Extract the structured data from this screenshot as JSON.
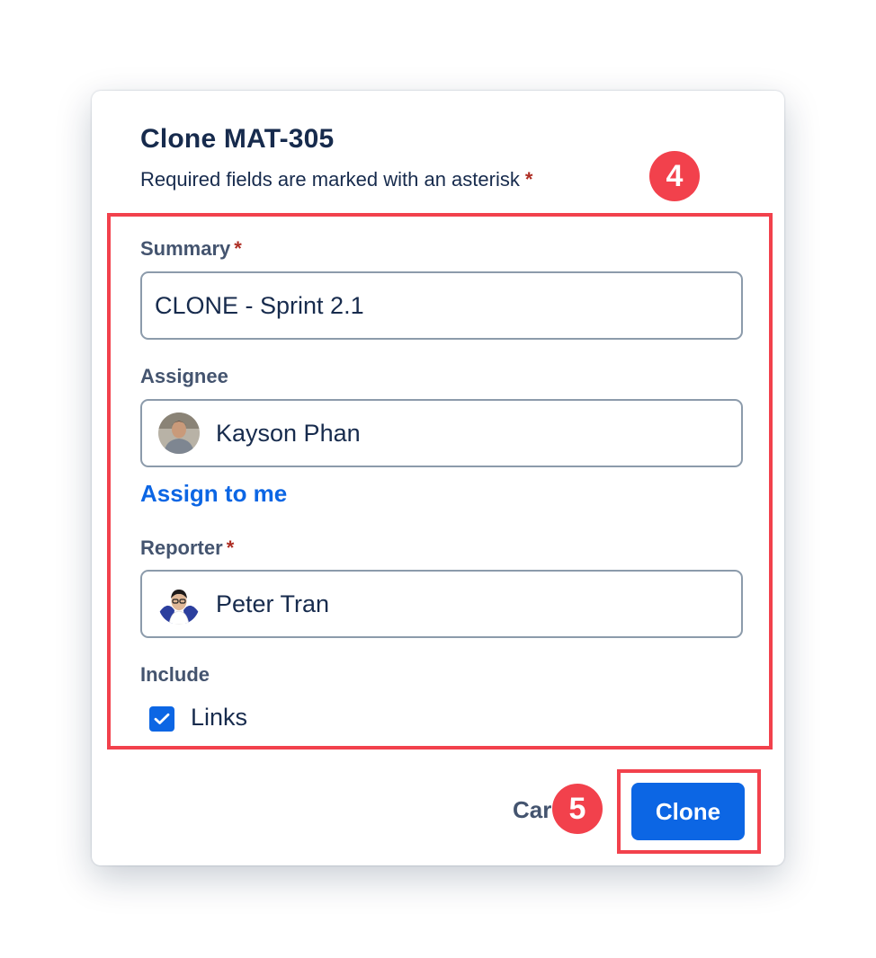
{
  "dialog": {
    "title": "Clone MAT-305",
    "subtitle": "Required fields are marked with an asterisk",
    "required_marker": "*"
  },
  "fields": {
    "summary": {
      "label": "Summary",
      "value": "CLONE - Sprint 2.1",
      "required_marker": "*"
    },
    "assignee": {
      "label": "Assignee",
      "value": "Kayson Phan",
      "avatar_icon": "user-avatar-kayson"
    },
    "assign_to_me": "Assign to me",
    "reporter": {
      "label": "Reporter",
      "value": "Peter Tran",
      "required_marker": "*",
      "avatar_icon": "user-avatar-peter"
    },
    "include": {
      "label": "Include",
      "options": [
        {
          "label": "Links",
          "checked": true
        }
      ]
    }
  },
  "footer": {
    "cancel_label": "Car",
    "clone_label": "Clone"
  },
  "annotations": {
    "step_4": "4",
    "step_5": "5",
    "color": "#f2414c"
  },
  "colors": {
    "primary": "#0c66e4",
    "text": "#172b4d",
    "subtle_text": "#44546f",
    "required": "#ae2e24",
    "input_border": "#8c9bab"
  }
}
